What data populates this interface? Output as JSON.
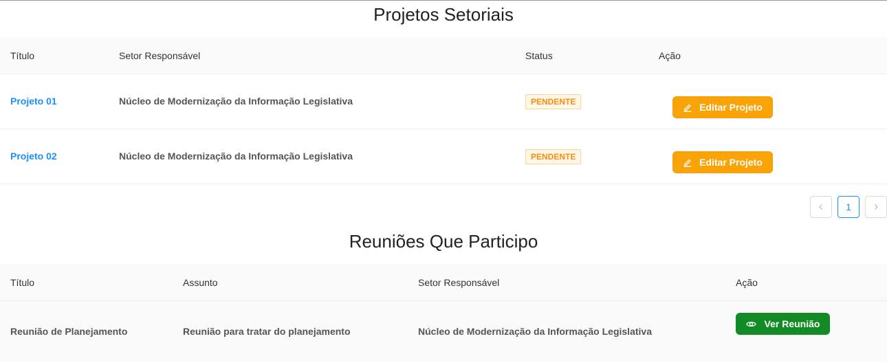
{
  "projects": {
    "title": "Projetos Setoriais",
    "headers": {
      "title": "Título",
      "sector": "Setor Responsável",
      "status": "Status",
      "action": "Ação"
    },
    "rows": [
      {
        "title": "Projeto 01",
        "sector": "Núcleo de Modernização da Informação Legislativa",
        "status": "PENDENTE",
        "action": "Editar Projeto"
      },
      {
        "title": "Projeto 02",
        "sector": "Núcleo de Modernização da Informação Legislativa",
        "status": "PENDENTE",
        "action": "Editar Projeto"
      }
    ],
    "pagination": {
      "current": "1"
    }
  },
  "meetings": {
    "title": "Reuniões Que Participo",
    "headers": {
      "title": "Título",
      "subject": "Assunto",
      "sector": "Setor Responsável",
      "action": "Ação"
    },
    "rows": [
      {
        "title": "Reunião de Planejamento",
        "subject": "Reunião para tratar do planejamento",
        "sector": "Núcleo de Modernização da Informação Legislativa",
        "action": "Ver Reunião"
      }
    ]
  },
  "icons": {
    "edit": "edit-icon",
    "view": "eye-icon",
    "prev": "chevron-left-icon",
    "next": "chevron-right-icon"
  },
  "colors": {
    "link": "#1890ff",
    "edit_button": "#faa307",
    "view_button": "#138b24",
    "tag_text": "#fa8c16"
  }
}
